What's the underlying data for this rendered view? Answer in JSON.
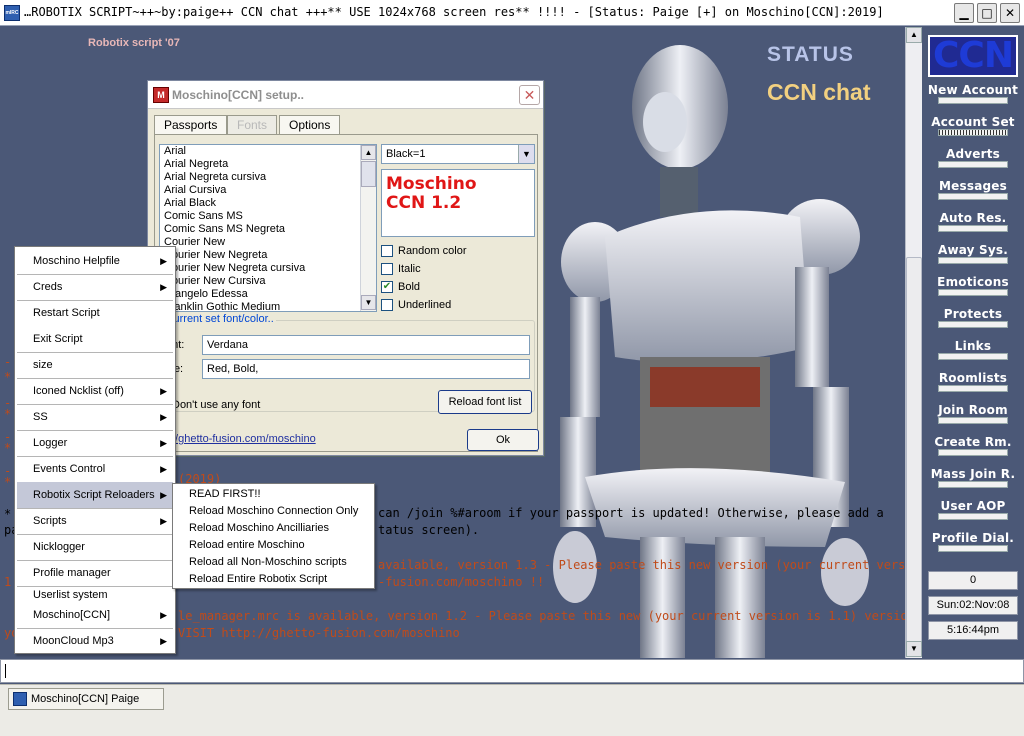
{
  "window": {
    "title": "…ROBOTIX SCRIPT~++~by:paige++ CCN chat +++** USE 1024x768 screen res** !!!! - [Status: Paige [+] on Moschino[CCN]:2019]",
    "min": "▁",
    "max": "□",
    "close": "✕"
  },
  "main": {
    "robotix_label": "Robotix script '07",
    "status_title": "STATUS",
    "ccn_chat": "CCN chat",
    "lines": {
      "l1": "(2019)",
      "l2": "can /join %#aroom if your passport is updated! Otherwise, please add a",
      "l3": "tatus screen).",
      "l4": "available, version 1.3 - Please paste this new version (your current version is",
      "l5": "-fusion.com/moschino !!",
      "l6": "le_manager.mrc is available, version 1.2 - Please paste this new (your current version is 1.1) version over",
      "l7": "VISIT http://ghetto-fusion.com/moschino",
      "prefix_pa": "pa",
      "prefix_1": "1.",
      "prefix_yo": "yo"
    },
    "bullets": [
      "-",
      "*",
      "-",
      "*",
      "-",
      "*",
      "-",
      "*",
      "-",
      "*",
      "*",
      "-",
      "*"
    ]
  },
  "sidebar": {
    "logo": "CCN",
    "items": [
      {
        "label": "New Account"
      },
      {
        "label": "Account Set"
      },
      {
        "label": "Adverts"
      },
      {
        "label": "Messages"
      },
      {
        "label": "Auto Res."
      },
      {
        "label": "Away Sys."
      },
      {
        "label": "Emoticons"
      },
      {
        "label": "Protects"
      },
      {
        "label": "Links"
      },
      {
        "label": "Roomlists"
      },
      {
        "label": "Join Room"
      },
      {
        "label": "Create Rm."
      },
      {
        "label": "Mass Join R."
      },
      {
        "label": "User AOP"
      },
      {
        "label": "Profile Dial."
      }
    ],
    "count": "0",
    "date": "Sun:02:Nov:08",
    "time": "5:16:44pm"
  },
  "dialog": {
    "title": "Moschino[CCN] setup..",
    "close": "✕",
    "tabs": [
      "Passports",
      "Fonts",
      "Options"
    ],
    "fonts": [
      "Arial",
      "Arial Negreta",
      "Arial Negreta cursiva",
      "Arial Cursiva",
      "Arial Black",
      "Comic Sans MS",
      "Comic Sans MS Negreta",
      "Courier New",
      "Courier New Negreta",
      "Courier New Negreta cursiva",
      "Courier New Cursiva",
      "Erangelo Edessa",
      "Franklin Gothic Medium"
    ],
    "color_value": "Black=1",
    "preview_line1": "Moschino",
    "preview_line2": "CCN 1.2",
    "checkboxes": [
      {
        "label": "Random color",
        "checked": ""
      },
      {
        "label": "Italic",
        "checked": ""
      },
      {
        "label": "Bold",
        "checked": "✔"
      },
      {
        "label": "Underlined",
        "checked": ""
      }
    ],
    "group_title": "current set font/color..",
    "font_label": "ont:",
    "font_value": "Verdana",
    "style_label": "yle:",
    "style_value": "Red, Bold,",
    "no_font": "Don't use any font",
    "reload_button": "Reload font list",
    "link": "//ghetto-fusion.com/moschino",
    "ok_button": "Ok"
  },
  "context_menu": {
    "items": [
      {
        "label": "Moschino Helpfile",
        "arrow": "▶"
      },
      {
        "label": "Creds",
        "arrow": "▶"
      },
      {
        "label": "Restart Script",
        "arrow": ""
      },
      {
        "label": "Exit Script",
        "arrow": ""
      },
      {
        "label": "size",
        "arrow": ""
      },
      {
        "label": "Iconed Ncklist (off)",
        "arrow": "▶"
      },
      {
        "label": "SS",
        "arrow": "▶"
      },
      {
        "label": "Logger",
        "arrow": "▶"
      },
      {
        "label": "Events Control",
        "arrow": "▶"
      },
      {
        "label": "Robotix Script Reloaders",
        "arrow": "▶"
      },
      {
        "label": "Scripts",
        "arrow": "▶"
      },
      {
        "label": "Nicklogger",
        "arrow": ""
      },
      {
        "label": "Profile manager",
        "arrow": ""
      },
      {
        "label": "Userlist system",
        "arrow": ""
      },
      {
        "label": "Moschino[CCN]",
        "arrow": "▶"
      },
      {
        "label": "MoonCloud Mp3",
        "arrow": "▶"
      }
    ]
  },
  "submenu": {
    "items": [
      "READ FIRST!!",
      "Reload Moschino Connection Only",
      "Reload Moschino Ancilliaries",
      "Reload entire Moschino",
      "Reload all Non-Moschino scripts",
      "Reload Entire Robotix Script"
    ]
  },
  "taskbar": {
    "item": "Moschino[CCN] Paige"
  },
  "scroll": {
    "up": "▲",
    "down": "▼",
    "grip": "≡"
  },
  "icons": {
    "app": "mIRC",
    "dialog": "M"
  }
}
